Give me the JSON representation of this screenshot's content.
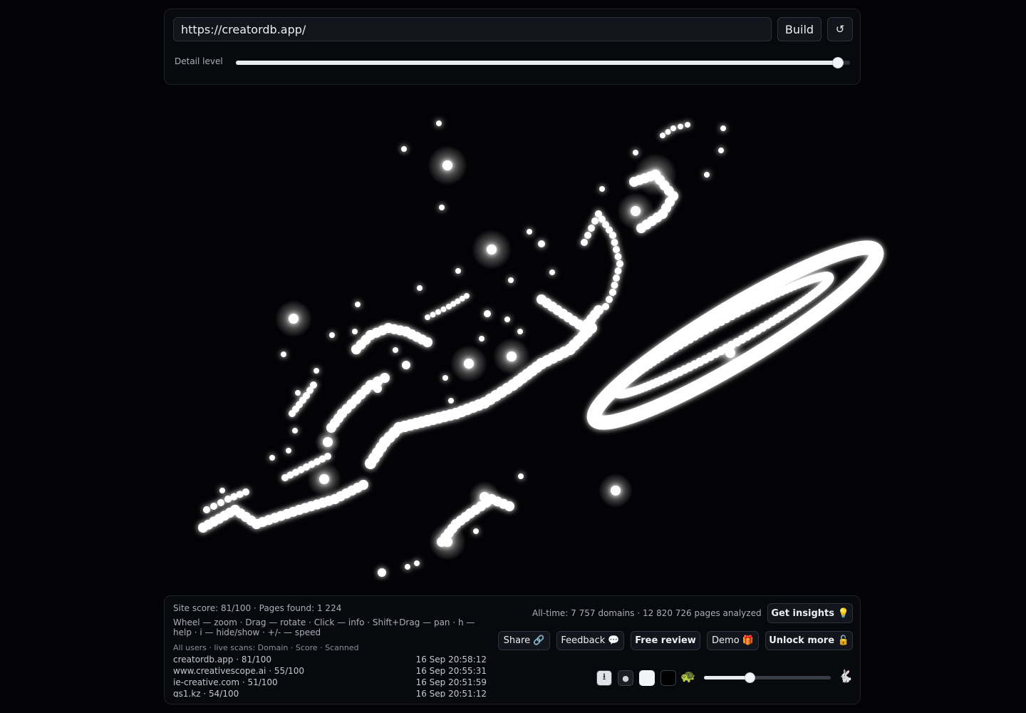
{
  "search": {
    "value": "https://creatordb.app/"
  },
  "toolbar": {
    "build_label": "Build",
    "reset_icon": "↺"
  },
  "detail": {
    "label": "Detail level",
    "value": 0.98
  },
  "stats": {
    "site_line": "Site score: 81/100 · Pages found: 1 224",
    "help": "Wheel — zoom · Drag — rotate · Click — info · Shift+Drag — pan · h — help · i — hide/show · +/- — speed",
    "feed_header": "All users · live scans: Domain · Score · Scanned",
    "alltime": "All-time: 7 757 domains · 12 820 726 pages analyzed"
  },
  "feed": [
    {
      "domain": "creatordb.app · 81/100",
      "time": "16 Sep 20:58:12"
    },
    {
      "domain": "www.creativescope.ai · 55/100",
      "time": "16 Sep 20:55:31"
    },
    {
      "domain": "ie-creative.com · 51/100",
      "time": "16 Sep 20:51:59"
    },
    {
      "domain": "gs1.kz · 54/100",
      "time": "16 Sep 20:51:12"
    }
  ],
  "actions": {
    "insights": "Get insights 💡",
    "share": "Share 🔗",
    "feedback": "Feedback 💬",
    "review": "Free review",
    "demo": "Demo 🎁",
    "unlock": "Unlock more 🔓"
  },
  "controls": {
    "download_icon": "⭳",
    "dot_icon": "●",
    "turtle_icon": "🐢",
    "rabbit_icon": "🐇",
    "speed_value": 0.36
  },
  "colors": {
    "background": "#030305",
    "glow": "#ffffff",
    "panel": "#07090d"
  }
}
